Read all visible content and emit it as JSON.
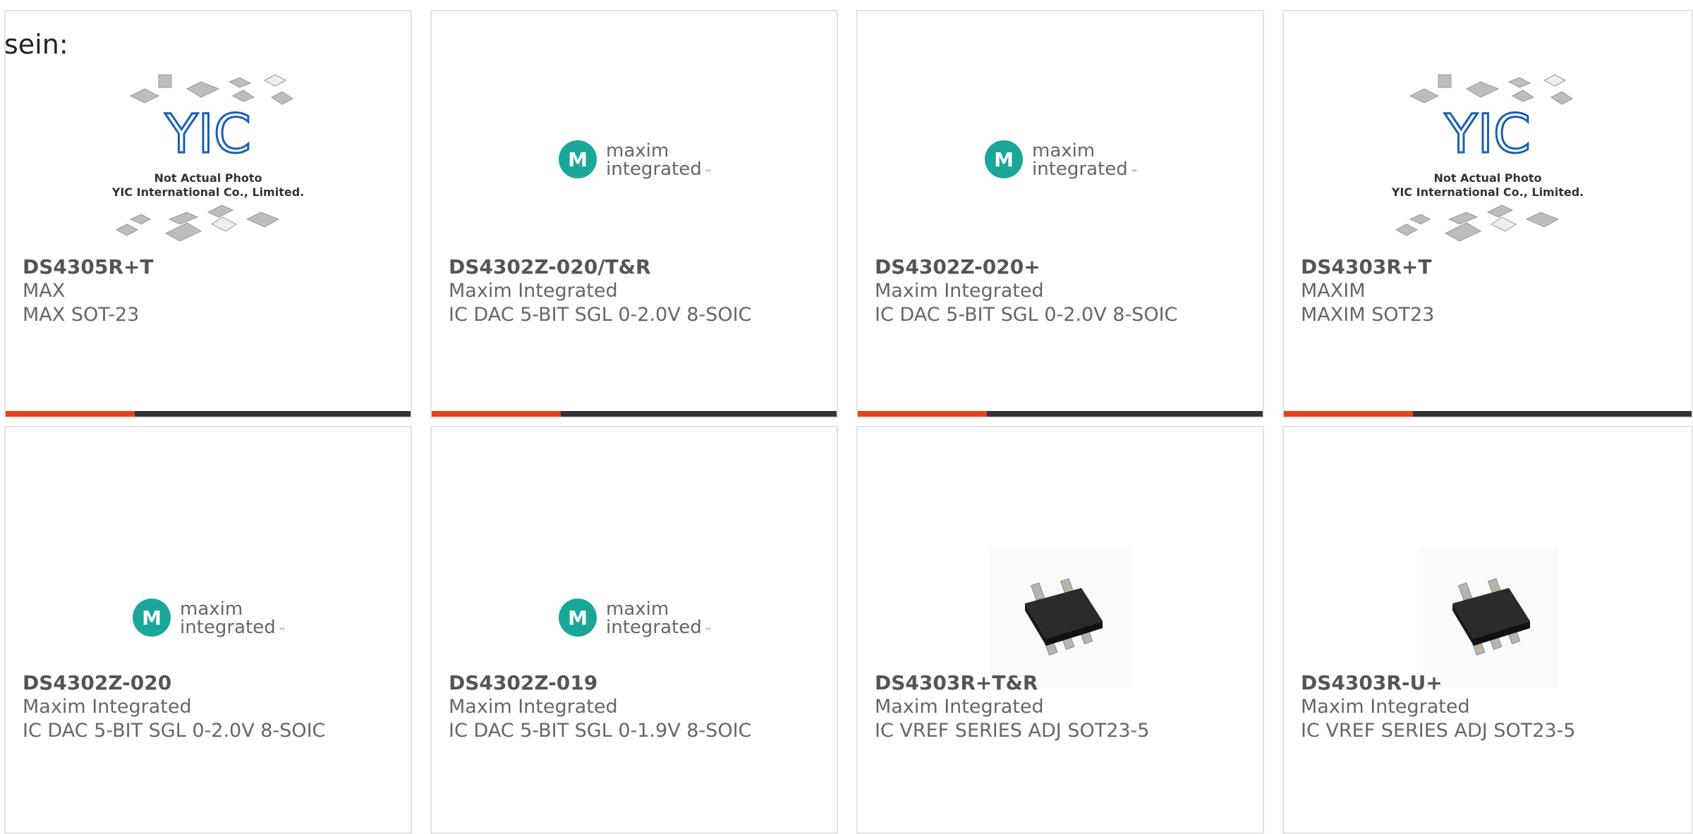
{
  "intro_text": "sein:",
  "colors": {
    "accent": "#e8401c",
    "bar": "#333333",
    "maxim_teal": "#1aa79a"
  },
  "products": [
    {
      "part_number": "DS4305R+T",
      "manufacturer": "MAX",
      "description": "MAX SOT-23",
      "image": "yic-placeholder",
      "has_bar": true
    },
    {
      "part_number": "DS4302Z-020/T&R",
      "manufacturer": "Maxim Integrated",
      "description": "IC DAC 5-BIT SGL 0-2.0V 8-SOIC",
      "image": "maxim-logo",
      "has_bar": true
    },
    {
      "part_number": "DS4302Z-020+",
      "manufacturer": "Maxim Integrated",
      "description": "IC DAC 5-BIT SGL 0-2.0V 8-SOIC",
      "image": "maxim-logo",
      "has_bar": true
    },
    {
      "part_number": "DS4303R+T",
      "manufacturer": "MAXIM",
      "description": "MAXIM SOT23",
      "image": "yic-placeholder",
      "has_bar": true
    },
    {
      "part_number": "DS4302Z-020",
      "manufacturer": "Maxim Integrated",
      "description": "IC DAC 5-BIT SGL 0-2.0V 8-SOIC",
      "image": "maxim-logo",
      "has_bar": false
    },
    {
      "part_number": "DS4302Z-019",
      "manufacturer": "Maxim Integrated",
      "description": "IC DAC 5-BIT SGL 0-1.9V 8-SOIC",
      "image": "maxim-logo",
      "has_bar": false
    },
    {
      "part_number": "DS4303R+T&R",
      "manufacturer": "Maxim Integrated",
      "description": "IC VREF SERIES ADJ SOT23-5",
      "image": "sot23-chip",
      "has_bar": false
    },
    {
      "part_number": "DS4303R-U+",
      "manufacturer": "Maxim Integrated",
      "description": "IC VREF SERIES ADJ SOT23-5",
      "image": "sot23-chip",
      "has_bar": false
    }
  ],
  "yic_placeholder": {
    "logo_text": "YIC",
    "line1": "Not Actual Photo",
    "line2": "YIC International Co., Limited."
  },
  "maxim_logo": {
    "word1": "maxim",
    "word2": "integrated",
    "tm": "™"
  }
}
